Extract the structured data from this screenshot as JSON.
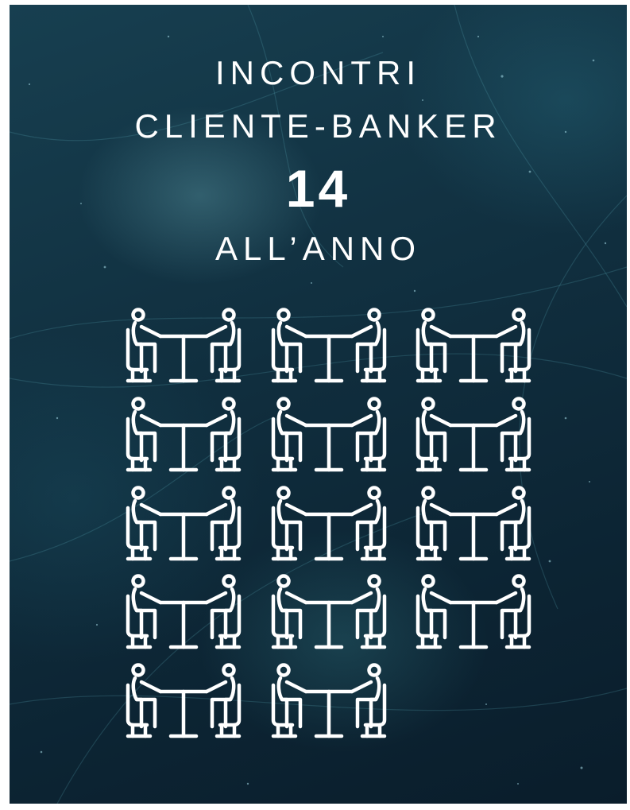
{
  "header": {
    "line1": "INCONTRI",
    "line2": "CLIENTE-BANKER",
    "count": "14",
    "line3": "ALL’ANNO"
  },
  "meetings": {
    "icon": "meeting-table-icon",
    "count": 14,
    "color": "#ffffff"
  },
  "colors": {
    "background_dark": "#0c2433",
    "background_light": "#173f50",
    "text": "#ffffff"
  }
}
